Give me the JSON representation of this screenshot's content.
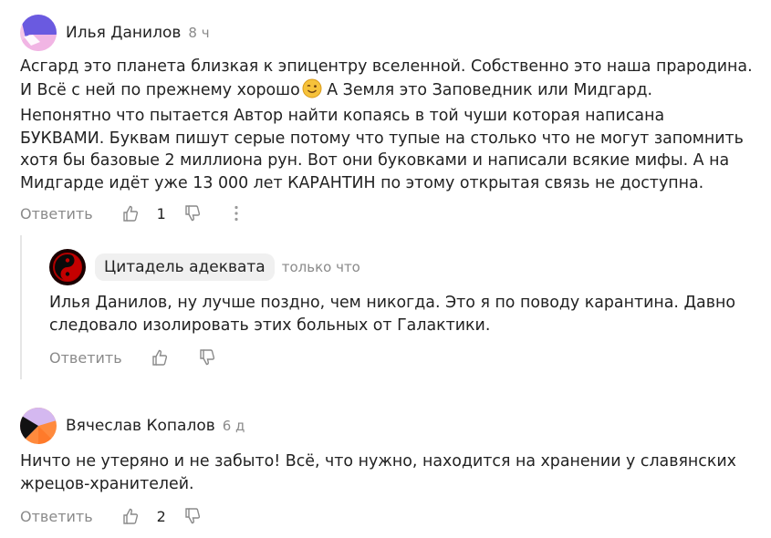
{
  "comments": [
    {
      "author": "Илья Данилов",
      "time": "8 ч",
      "lines": [
        "Асгард это планета близкая к эпицентру вселенной. Собственно это наша прародина.",
        "И Всё с ней по прежнему хорошо",
        "Непонятно что пытается Автор найти копаясь в той чуши которая написана",
        "БУКВАМИ. Буквам пишут серые потому что тупые на столько что не могут запомнить",
        "хотя бы базовые 2 миллиона рун. Вот они буковками и написали всякие мифы. А на",
        "Мидгарде идёт уже 13 000 лет КАРАНТИН по этому открытая связь не доступна."
      ],
      "line2_after_emoji": " А Земля это Заповедник или Мидгард.",
      "emoji": "wink-emoji",
      "reply_label": "Ответить",
      "likes": "1"
    },
    {
      "author": "Цитадель адеквата",
      "time": "только что",
      "lines": [
        "Илья Данилов, ну лучше поздно, чем никогда. Это я по поводу карантина. Давно",
        "следовало изолировать этих больных от Галактики."
      ],
      "reply_label": "Ответить"
    },
    {
      "author": "Вячеслав Копалов",
      "time": "6 д",
      "lines": [
        "Ничто не утеряно и не забыто! Всё, что нужно, находится на хранении у славянских",
        "жрецов-хранителей."
      ],
      "reply_label": "Ответить",
      "likes": "2"
    }
  ],
  "colors": {
    "text": "#222222",
    "muted": "#8a8a8a",
    "pill_bg": "#f0f0f0",
    "thread_line": "#e6e6e6"
  },
  "icons": [
    "thumbs-up-icon",
    "thumbs-down-icon",
    "more-vertical-icon"
  ]
}
